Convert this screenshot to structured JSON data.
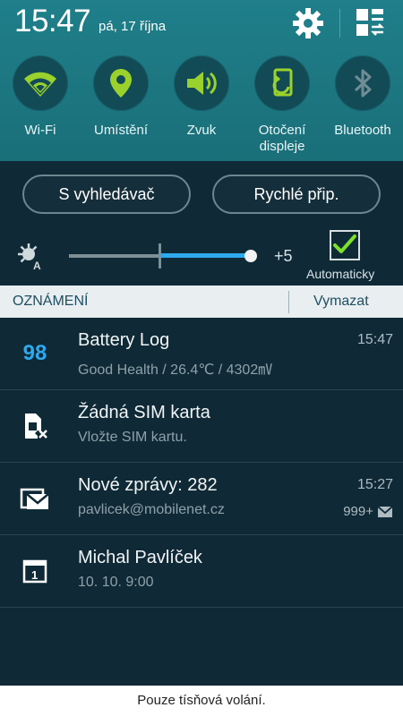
{
  "status": {
    "time": "15:47",
    "date": "pá, 17 října"
  },
  "toggles": [
    {
      "label": "Wi-Fi",
      "icon": "wifi-icon",
      "active": true
    },
    {
      "label": "Umístění",
      "icon": "location-icon",
      "active": true
    },
    {
      "label": "Zvuk",
      "icon": "sound-icon",
      "active": true
    },
    {
      "label": "Otočení\ndispleje",
      "icon": "rotate-icon",
      "active": true
    },
    {
      "label": "Bluetooth",
      "icon": "bluetooth-icon",
      "active": false
    }
  ],
  "buttons": {
    "finder": "S vyhledávač",
    "quick_connect": "Rychlé přip."
  },
  "brightness": {
    "value_label": "+5",
    "auto_label": "Automaticky",
    "auto_checked": true,
    "level": 0.5
  },
  "notifications": {
    "header": "OZNÁMENÍ",
    "clear": "Vymazat",
    "items": [
      {
        "icon": "battery-level-icon",
        "icon_text": "98",
        "title": "Battery Log",
        "subtitle": "Good Health / 26.4℃ / 4302㎷",
        "time": "15:47"
      },
      {
        "icon": "no-sim-icon",
        "title": "Žádná SIM karta",
        "subtitle": "Vložte SIM kartu."
      },
      {
        "icon": "mail-icon",
        "title": "Nové zprávy: 282",
        "subtitle": "pavlicek@mobilenet.cz",
        "time": "15:27",
        "count": "999+"
      },
      {
        "icon": "calendar-icon",
        "title": "Michal Pavlíček",
        "subtitle": "10. 10. 9:00"
      }
    ]
  },
  "footer": "Pouze tísňová volání.",
  "colors": {
    "accent": "#9ad12d",
    "slider": "#2ea8ef",
    "panel": "#1f7f8a",
    "background": "#0f2a36"
  }
}
